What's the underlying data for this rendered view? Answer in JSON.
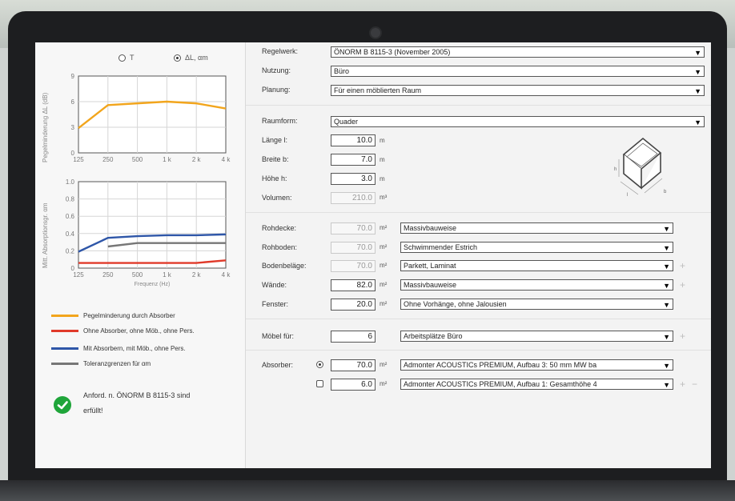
{
  "chart_data": [
    {
      "type": "line",
      "xlabel": "",
      "ylabel": "Pegelminderung ΔL (dB)",
      "x_ticks": [
        "125",
        "250",
        "500",
        "1 k",
        "2 k",
        "4 k"
      ],
      "y_ticks": [
        0,
        3,
        6,
        9
      ],
      "ylim": [
        0,
        9
      ],
      "grid": true,
      "series": [
        {
          "name": "Pegelminderung durch Absorber",
          "color": "#f2a51c",
          "values": [
            2.9,
            5.6,
            5.8,
            6.0,
            5.8,
            5.2
          ]
        }
      ]
    },
    {
      "type": "line",
      "xlabel": "Frequenz (Hz)",
      "ylabel": "Mitt. Absorptionsgr. αm",
      "x_ticks": [
        "125",
        "250",
        "500",
        "1 k",
        "2 k",
        "4 k"
      ],
      "y_ticks": [
        0,
        0.2,
        0.4,
        0.6,
        0.8,
        1.0
      ],
      "ylim": [
        0,
        1.0
      ],
      "grid": true,
      "series": [
        {
          "name": "Ohne Absorber, ohne Möb., ohne Pers.",
          "color": "#e03a2a",
          "values": [
            0.06,
            0.06,
            0.06,
            0.06,
            0.06,
            0.09
          ]
        },
        {
          "name": "Mit Absorbern, mit Möb., ohne Pers.",
          "color": "#2e56a8",
          "values": [
            0.19,
            0.35,
            0.37,
            0.38,
            0.38,
            0.39
          ]
        },
        {
          "name": "Toleranzgrenzen für αm",
          "color": "#777777",
          "values": [
            null,
            0.25,
            0.29,
            0.29,
            0.29,
            0.29
          ]
        }
      ]
    }
  ],
  "left": {
    "radio_t": "T",
    "radio_dl": "ΔL, αm",
    "legend": [
      {
        "label": "Pegelminderung durch Absorber",
        "color": "#f2a51c"
      },
      {
        "label": "Ohne Absorber, ohne Möb., ohne Pers.",
        "color": "#e03a2a"
      },
      {
        "label": "Mit Absorbern, mit Möb., ohne Pers.",
        "color": "#2e56a8"
      },
      {
        "label": "Toleranzgrenzen für αm",
        "color": "#777777"
      }
    ],
    "status_line1": "Anford. n. ÖNORM B 8115-3 sind",
    "status_line2": "erfüllt!",
    "status_color": "#1fa53a"
  },
  "form": {
    "regelwerk": {
      "label": "Regelwerk:",
      "value": "ÖNORM B 8115-3 (November 2005)"
    },
    "nutzung": {
      "label": "Nutzung:",
      "value": "Büro"
    },
    "planung": {
      "label": "Planung:",
      "value": "Für einen möblierten Raum"
    },
    "raumform": {
      "label": "Raumform:",
      "value": "Quader"
    },
    "laenge": {
      "label": "Länge l:",
      "value": "10.0",
      "unit": "m"
    },
    "breite": {
      "label": "Breite b:",
      "value": "7.0",
      "unit": "m"
    },
    "hoehe": {
      "label": "Höhe h:",
      "value": "3.0",
      "unit": "m"
    },
    "volumen": {
      "label": "Volumen:",
      "value": "210.0",
      "unit": "m³"
    },
    "rohdecke": {
      "label": "Rohdecke:",
      "value": "70.0",
      "unit": "m²",
      "select": "Massivbauweise"
    },
    "rohboden": {
      "label": "Rohboden:",
      "value": "70.0",
      "unit": "m²",
      "select": "Schwimmender Estrich"
    },
    "bodenbelag": {
      "label": "Bodenbeläge:",
      "value": "70.0",
      "unit": "m²",
      "select": "Parkett, Laminat"
    },
    "waende": {
      "label": "Wände:",
      "value": "82.0",
      "unit": "m²",
      "select": "Massivbauweise"
    },
    "fenster": {
      "label": "Fenster:",
      "value": "20.0",
      "unit": "m²",
      "select": "Ohne Vorhänge, ohne Jalousien"
    },
    "moebel": {
      "label": "Möbel für:",
      "value": "6",
      "select": "Arbeitsplätze Büro"
    },
    "absorber_label": "Absorber:",
    "absorber1": {
      "value": "70.0",
      "unit": "m²",
      "select": "Admonter ACOUSTICs PREMIUM, Aufbau 3: 50 mm MW ba"
    },
    "absorber2": {
      "value": "6.0",
      "unit": "m²",
      "select": "Admonter ACOUSTICs PREMIUM, Aufbau 1: Gesamthöhe 4"
    },
    "dims": {
      "l": "l",
      "b": "b",
      "h": "h"
    },
    "arrow": "▼",
    "plus": "+",
    "minus": "−"
  }
}
